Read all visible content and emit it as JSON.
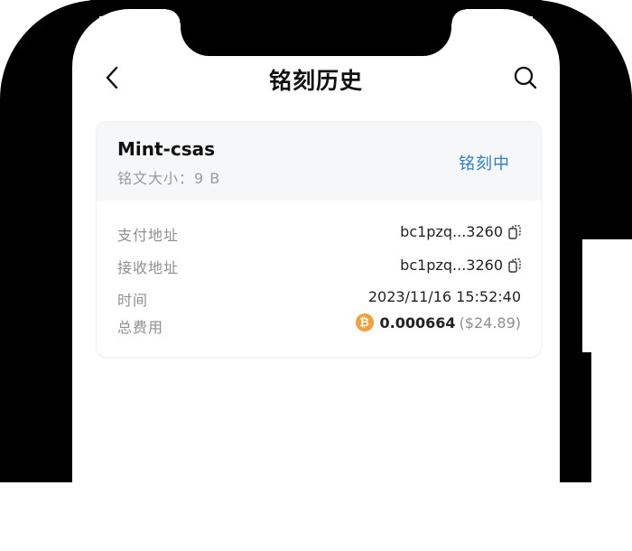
{
  "header": {
    "title": "铭刻历史",
    "back_icon": "chevron-left-icon",
    "search_icon": "search-icon"
  },
  "inscription": {
    "name": "Mint-csas",
    "size_label": "铭文大小：9 B",
    "status": "铭刻中",
    "status_color": "#2d7fc8",
    "rows": {
      "pay_address_label": "支付地址",
      "pay_address_value": "bc1pzq...3260",
      "receive_address_label": "接收地址",
      "receive_address_value": "bc1pzq...3260",
      "time_label": "时间",
      "time_value": "2023/11/16 15:52:40",
      "fee_label": "总费用",
      "fee_icon_glyph": "₿",
      "fee_btc": "0.000664",
      "fee_usd": "($24.89)"
    }
  },
  "colors": {
    "bitcoin": "#f2a03d",
    "card_header_bg": "#f6f7f8"
  }
}
